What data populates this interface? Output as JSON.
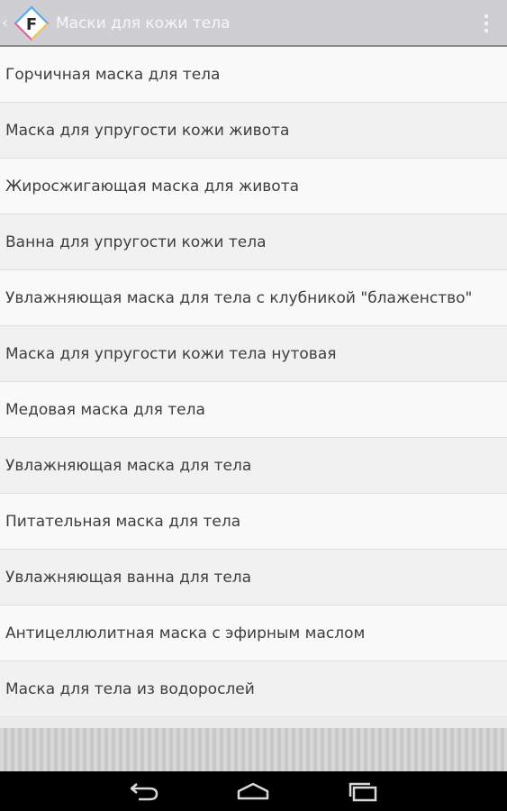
{
  "action_bar": {
    "title": "Маски для кожи тела",
    "up_icon": "chevron-left-icon",
    "app_icon_letter": "F",
    "app_icon": "app-logo-icon",
    "overflow_icon": "overflow-menu-icon"
  },
  "list": {
    "items": [
      {
        "label": "Горчичная маска для тела"
      },
      {
        "label": "Маска для упругости кожи живота"
      },
      {
        "label": "Жиросжигающая маска для живота"
      },
      {
        "label": "Ванна для упругости кожи тела"
      },
      {
        "label": "Увлажняющая маска для тела с клубникой \"блаженство\""
      },
      {
        "label": "Маска для упругости кожи тела нутовая"
      },
      {
        "label": "Медовая маска для тела"
      },
      {
        "label": "Увлажняющая маска для тела"
      },
      {
        "label": "Питательная маска для тела"
      },
      {
        "label": "Увлажняющая ванна для тела"
      },
      {
        "label": "Антицеллюлитная маска с эфирным маслом"
      },
      {
        "label": "Маска для тела из водорослей"
      }
    ]
  },
  "nav_bar": {
    "back_icon": "back-arrow-icon",
    "home_icon": "home-icon",
    "recent_icon": "recent-apps-icon"
  },
  "colors": {
    "action_bar": "#cfcfd3",
    "row_light": "#f9f9f9",
    "row_dark": "#f1f1f1",
    "text": "#3e3e3e",
    "nav_bar": "#000000"
  }
}
